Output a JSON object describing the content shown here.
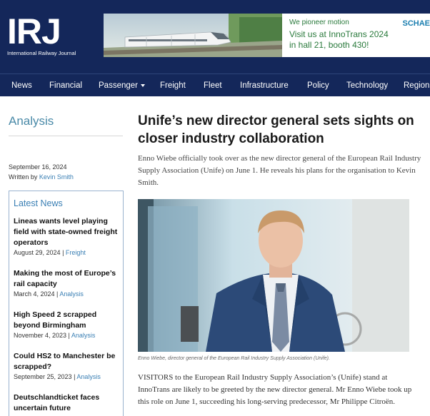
{
  "header": {
    "logo": "IRJ",
    "logo_subtitle": "International Railway Journal",
    "banner": {
      "tagline": "We pioneer motion",
      "line1": "Visit us at InnoTrans 2024",
      "line2": "in hall 21, booth 430!",
      "brand": "SCHAE"
    }
  },
  "nav": {
    "items": [
      "News",
      "Financial",
      "Passenger",
      "Freight",
      "Fleet",
      "Infrastructure",
      "Policy",
      "Technology",
      "Regions"
    ]
  },
  "sidebar": {
    "section": "Analysis",
    "date": "September 16, 2024",
    "byline_prefix": "Written by",
    "author": "Kevin Smith",
    "latest_title": "Latest News",
    "latest": [
      {
        "title": "Lineas wants level playing field with state-owned freight operators",
        "date": "August 29, 2024",
        "category": "Freight"
      },
      {
        "title": "Making the most of Europe’s rail capacity",
        "date": "March 4, 2024",
        "category": "Analysis"
      },
      {
        "title": "High Speed 2 scrapped beyond Birmingham",
        "date": "November 4, 2023",
        "category": "Analysis"
      },
      {
        "title": "Could HS2 to Manchester be scrapped?",
        "date": "September 25, 2023",
        "category": "Analysis"
      },
      {
        "title": "Deutschlandticket faces uncertain future",
        "date": "",
        "category": ""
      }
    ]
  },
  "article": {
    "headline": "Unife’s new director general sets sights on closer industry collaboration",
    "standfirst": "Enno Wiebe officially took over as the new director general of the European Rail Industry Supply Association (Unife) on June 1. He reveals his plans for the organisation to Kevin Smith.",
    "caption": "Enno Wiebe, director general of the European Rail Industry Supply Association (Unife).",
    "body": "VISITORS to the European Rail Industry Supply Association’s (Unife) stand at InnoTrans are likely to be greeted by the new director general. Mr Enno Wiebe took up this role on June 1, succeeding his long-serving predecessor, Mr Philippe Citroën."
  },
  "colors": {
    "header_bg": "#14275a",
    "link": "#3a7fb4",
    "banner_text": "#2a7a3c"
  }
}
